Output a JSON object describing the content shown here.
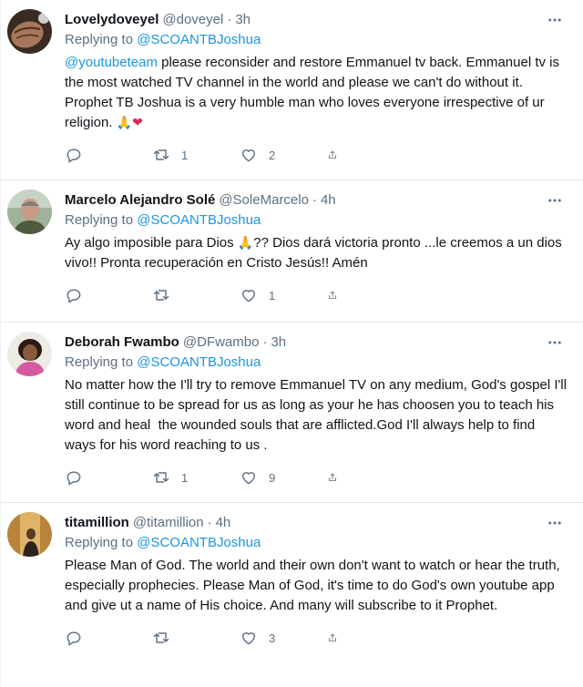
{
  "colors": {
    "link": "#1b95e0",
    "secondary": "#5b7083",
    "text": "#0f1419",
    "divider": "#e1e8ed"
  },
  "tweets": [
    {
      "name": "Lovelydoveyel",
      "handle": "@doveyel",
      "dot": "·",
      "time": "3h",
      "replying_label": "Replying to",
      "replying_to": "@SCOANTBJoshua",
      "mention": "@youtubeteam",
      "text": " please reconsider and restore Emmanuel tv back. Emmanuel tv is the most watched TV channel in the world and please we can't do without it. Prophet TB Joshua is a very humble man who loves everyone irrespective of ur religion. ",
      "emoji_1": "🙏",
      "emoji_2": "❤",
      "retweets": "1",
      "likes": "2"
    },
    {
      "name": "Marcelo Alejandro Solé",
      "handle": "@SoleMarcelo",
      "dot": "·",
      "time": "4h",
      "replying_label": "Replying to",
      "replying_to": "@SCOANTBJoshua",
      "text_a": "Ay algo imposible para Dios ",
      "emoji_1": "🙏",
      "text_b": "?? Dios dará victoria pronto ...le creemos a un dios vivo!! Pronta recuperación en Cristo Jesús!! Amén",
      "retweets": "",
      "likes": "1"
    },
    {
      "name": "Deborah Fwambo",
      "handle": "@DFwambo",
      "dot": "·",
      "time": "3h",
      "replying_label": "Replying to",
      "replying_to": "@SCOANTBJoshua",
      "text": "No matter how the I'll try to remove Emmanuel TV on any medium, God's gospel I'll still continue to be spread for us as long as your he has choosen you to teach his word and heal  the wounded souls that are afflicted.God I'll always help to find ways for his word reaching to us .",
      "retweets": "1",
      "likes": "9"
    },
    {
      "name": "titamillion",
      "handle": "@titamillion",
      "dot": "·",
      "time": "4h",
      "replying_label": "Replying to",
      "replying_to": "@SCOANTBJoshua",
      "text": "Please Man of God. The world and their own don't want to watch or hear the truth, especially prophecies. Please Man of God, it's time to do God's own youtube app and give ut a name of His choice. And many will subscribe to it Prophet.",
      "retweets": "",
      "likes": "3"
    }
  ]
}
